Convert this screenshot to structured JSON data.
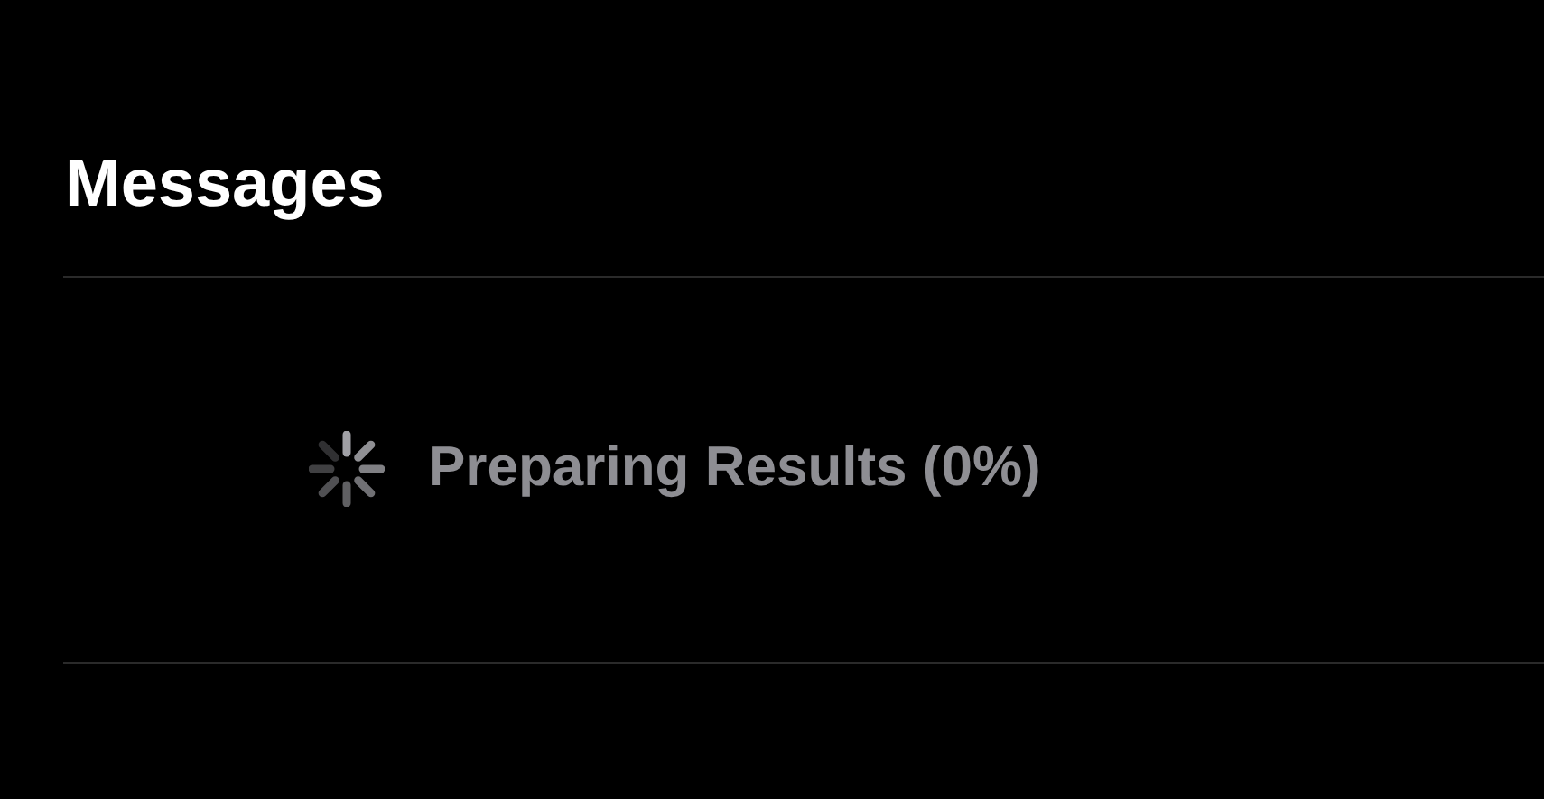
{
  "section": {
    "title": "Messages"
  },
  "status": {
    "text": "Preparing Results (0%)"
  }
}
